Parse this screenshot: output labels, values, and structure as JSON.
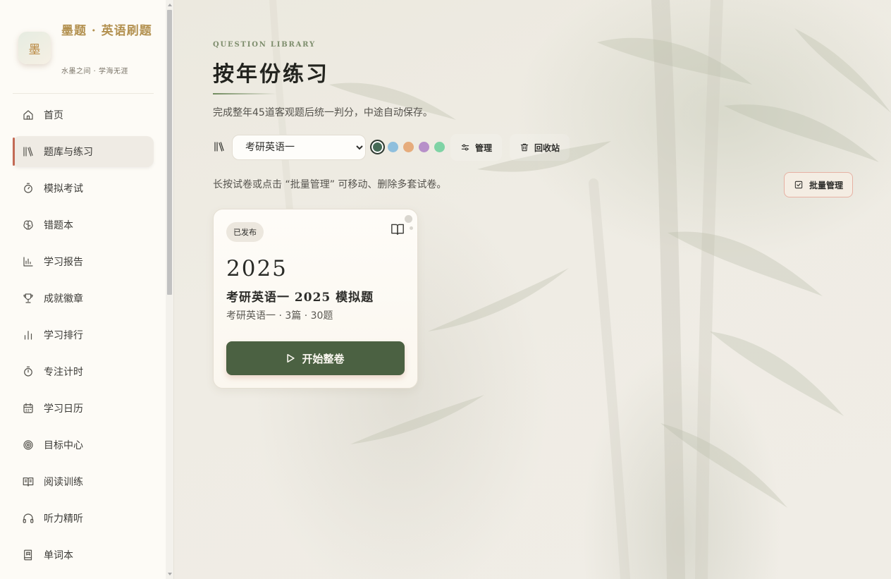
{
  "sidebar": {
    "brand": {
      "logo_char": "墨",
      "title": "墨题 · 英语刷题",
      "subtitle": "水墨之间 · 学海无涯"
    },
    "items": [
      {
        "label": "首页",
        "icon": "home-icon",
        "active": false
      },
      {
        "label": "题库与练习",
        "icon": "library-icon",
        "active": true
      },
      {
        "label": "模拟考试",
        "icon": "stopwatch-icon",
        "active": false
      },
      {
        "label": "错题本",
        "icon": "brain-icon",
        "active": false
      },
      {
        "label": "学习报告",
        "icon": "bar-chart-icon",
        "active": false
      },
      {
        "label": "成就徽章",
        "icon": "trophy-icon",
        "active": false
      },
      {
        "label": "学习排行",
        "icon": "ranking-icon",
        "active": false
      },
      {
        "label": "专注计时",
        "icon": "timer-icon",
        "active": false
      },
      {
        "label": "学习日历",
        "icon": "calendar-icon",
        "active": false
      },
      {
        "label": "目标中心",
        "icon": "target-icon",
        "active": false
      },
      {
        "label": "阅读训练",
        "icon": "open-book-icon",
        "active": false
      },
      {
        "label": "听力精听",
        "icon": "headphones-icon",
        "active": false
      },
      {
        "label": "单词本",
        "icon": "notebook-icon",
        "active": false
      }
    ]
  },
  "main": {
    "eyebrow": "QUESTION LIBRARY",
    "title": "按年份练习",
    "description": "完成整年45道客观题后统一判分，中途自动保存。",
    "toolbar": {
      "select_value": "考研英语一",
      "select_options": [
        "考研英语一"
      ],
      "swatches": [
        "#456b57",
        "#8fbfdd",
        "#e6ac7c",
        "#b790c9",
        "#7fd3a5"
      ],
      "selected_swatch": 0,
      "manage_label": "管理",
      "recycle_label": "回收站"
    },
    "hint": "长按试卷或点击 “批量管理” 可移动、删除多套试卷。",
    "batch_label": "批量管理",
    "card": {
      "badge": "已发布",
      "year": "2025",
      "name": "考研英语一 2025 模拟题",
      "meta": "考研英语一 · 3篇 · 30题",
      "start_label": "开始整卷"
    }
  }
}
